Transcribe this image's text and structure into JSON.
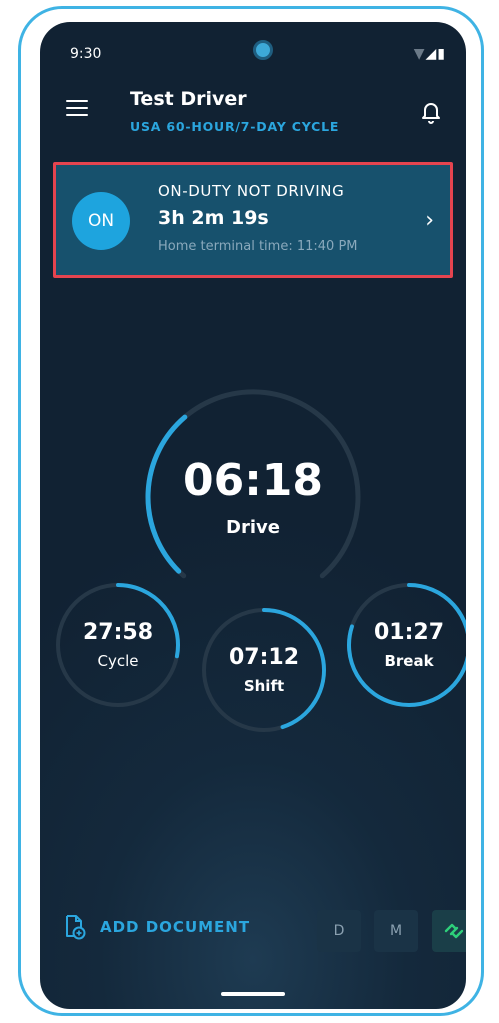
{
  "status_bar": {
    "time": "9:30"
  },
  "header": {
    "driver_name": "Test Driver",
    "cycle": "USA 60-HOUR/7-DAY CYCLE"
  },
  "duty_status": {
    "badge": "ON",
    "title": "ON-DUTY NOT DRIVING",
    "elapsed": "3h 2m 19s",
    "home_terminal": "Home terminal time: 11:40 PM"
  },
  "gauges": {
    "drive": {
      "value": "06:18",
      "label": "Drive",
      "progress": 0.35
    },
    "cycle": {
      "value": "27:58",
      "label": "Cycle",
      "progress": 0.28
    },
    "shift": {
      "value": "07:12",
      "label": "Shift",
      "progress": 0.45
    },
    "break": {
      "value": "01:27",
      "label": "Break",
      "progress": 0.8
    }
  },
  "bottom": {
    "add_document": "ADD DOCUMENT",
    "mode_d": "D",
    "mode_m": "M"
  },
  "colors": {
    "accent": "#2ba6de",
    "track": "#263848",
    "highlight": "#e5444f",
    "connected": "#2ecf7a"
  },
  "icons": [
    "menu-icon",
    "bell-icon",
    "document-add-icon",
    "link-icon",
    "chevron-right-icon"
  ]
}
